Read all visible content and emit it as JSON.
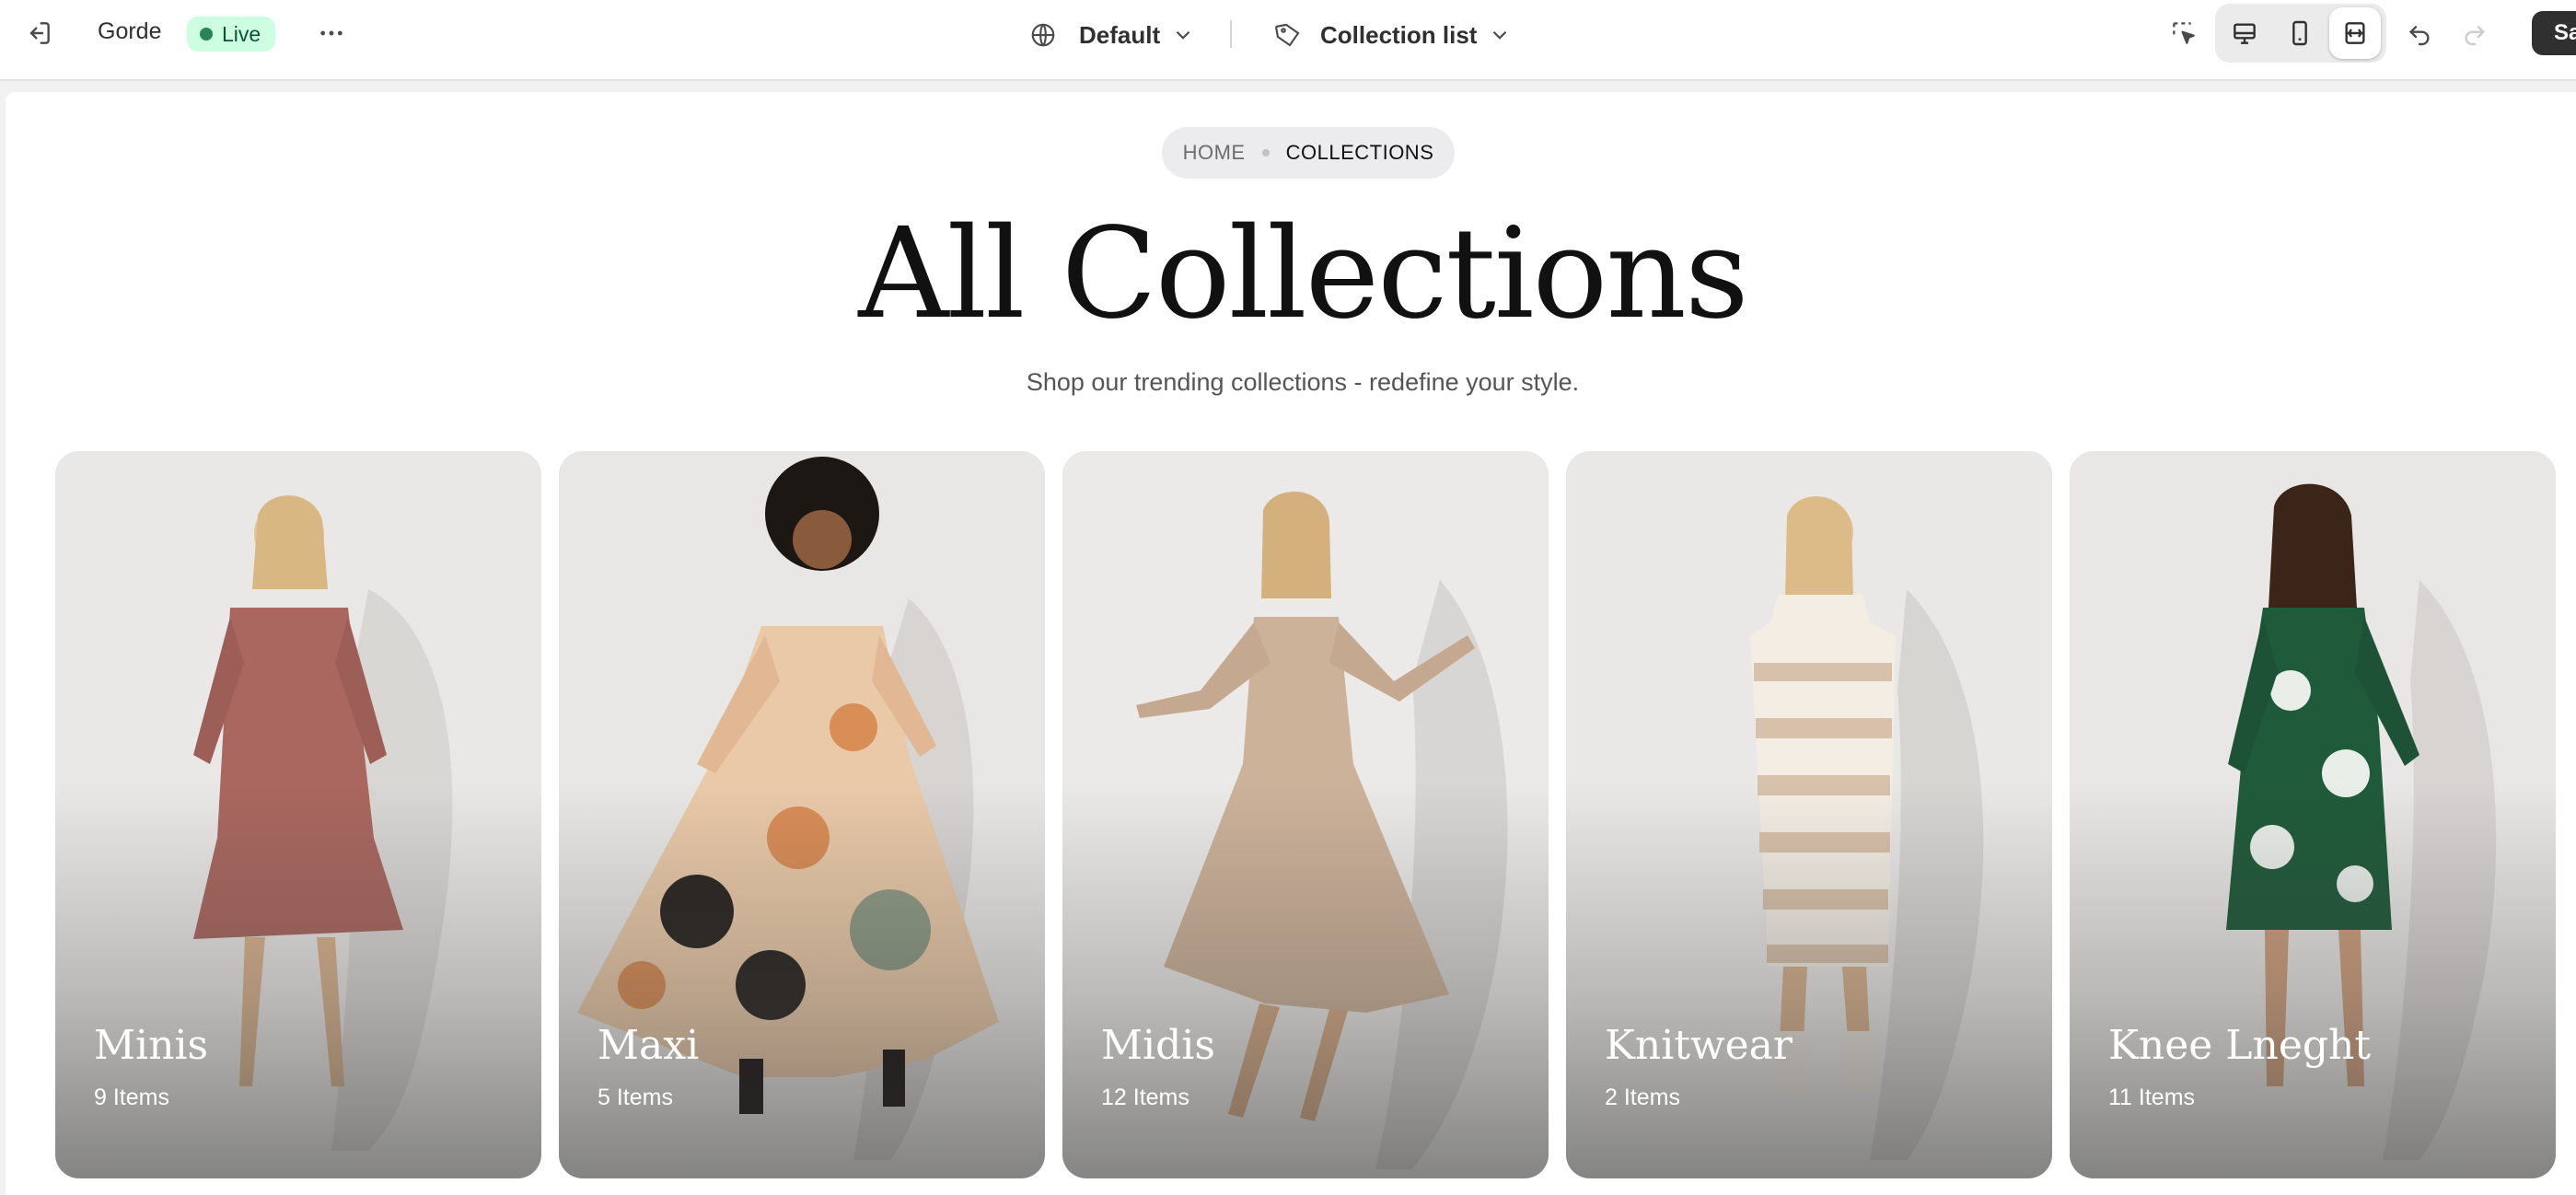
{
  "topbar": {
    "exit_icon": "exit-icon",
    "store_name": "Gorde",
    "status_label": "Live",
    "more_icon": "more-horizontal-icon",
    "theme_selector": {
      "icon": "globe-icon",
      "label": "Default"
    },
    "template_selector": {
      "icon": "tag-icon",
      "label": "Collection list"
    },
    "inspector_icon": "select-cursor-icon",
    "device_toggle": {
      "desktop_icon": "desktop-icon",
      "mobile_icon": "mobile-icon",
      "fullwidth_icon": "full-width-icon",
      "active": "full-width"
    },
    "undo_icon": "undo-icon",
    "redo_icon": "redo-icon",
    "save_label": "Sa"
  },
  "page": {
    "breadcrumb": {
      "home": "HOME",
      "current": "COLLECTIONS"
    },
    "title": "All Collections",
    "subtitle": "Shop our trending collections - redefine your style."
  },
  "collections": [
    {
      "name": "Minis",
      "count": "9 Items",
      "dress_color": "#a9675f"
    },
    {
      "name": "Maxi",
      "count": "5 Items",
      "dress_color": "#e9c9a8"
    },
    {
      "name": "Midis",
      "count": "12 Items",
      "dress_color": "#cdb29a"
    },
    {
      "name": "Knitwear",
      "count": "2 Items",
      "dress_color": "#d8c1ab"
    },
    {
      "name": "Knee Lneght",
      "count": "11 Items",
      "dress_color": "#1f5a3a"
    }
  ],
  "colors": {
    "live_badge_bg": "#cdfee1",
    "live_dot": "#29845a",
    "breadcrumb_bg": "#ececee"
  }
}
